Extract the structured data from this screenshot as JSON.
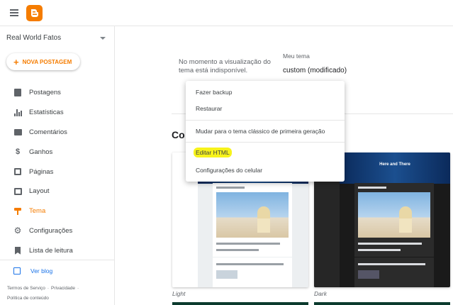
{
  "header": {
    "logo_icon": "blogger-logo-icon",
    "menu_icon": "hamburger-icon"
  },
  "sidebar": {
    "blog_name": "Real World Fatos",
    "new_post_label": "NOVA POSTAGEM",
    "items": [
      {
        "label": "Postagens",
        "icon": "posts-icon"
      },
      {
        "label": "Estatísticas",
        "icon": "stats-icon"
      },
      {
        "label": "Comentários",
        "icon": "comments-icon"
      },
      {
        "label": "Ganhos",
        "icon": "dollar-icon"
      },
      {
        "label": "Páginas",
        "icon": "pages-icon"
      },
      {
        "label": "Layout",
        "icon": "layout-icon"
      },
      {
        "label": "Tema",
        "icon": "paint-roller-icon",
        "active": true
      },
      {
        "label": "Configurações",
        "icon": "gear-icon"
      },
      {
        "label": "Lista de leitura",
        "icon": "bookmark-icon"
      }
    ],
    "view_blog_label": "Ver blog",
    "footer": {
      "terms": "Termos de Serviço",
      "privacy": "Privacidade",
      "content_policy": "Política de conteúdo"
    }
  },
  "main": {
    "preview_message": "No momento a visualização do tema está indisponível.",
    "my_theme_label": "Meu tema",
    "theme_name": "custom (modificado)",
    "section_title": "Co",
    "themes": [
      {
        "caption": "Light"
      },
      {
        "caption": "Dark"
      }
    ],
    "dark_hero_title": "Here and There"
  },
  "menu": {
    "backup": "Fazer backup",
    "restore": "Restaurar",
    "classic": "Mudar para o tema clássico de primeira geração",
    "edit_html": "Editar HTML",
    "mobile_settings": "Configurações do celular"
  },
  "colors": {
    "accent": "#f57c00",
    "link": "#1a73e8",
    "highlight": "#f7f31b"
  }
}
